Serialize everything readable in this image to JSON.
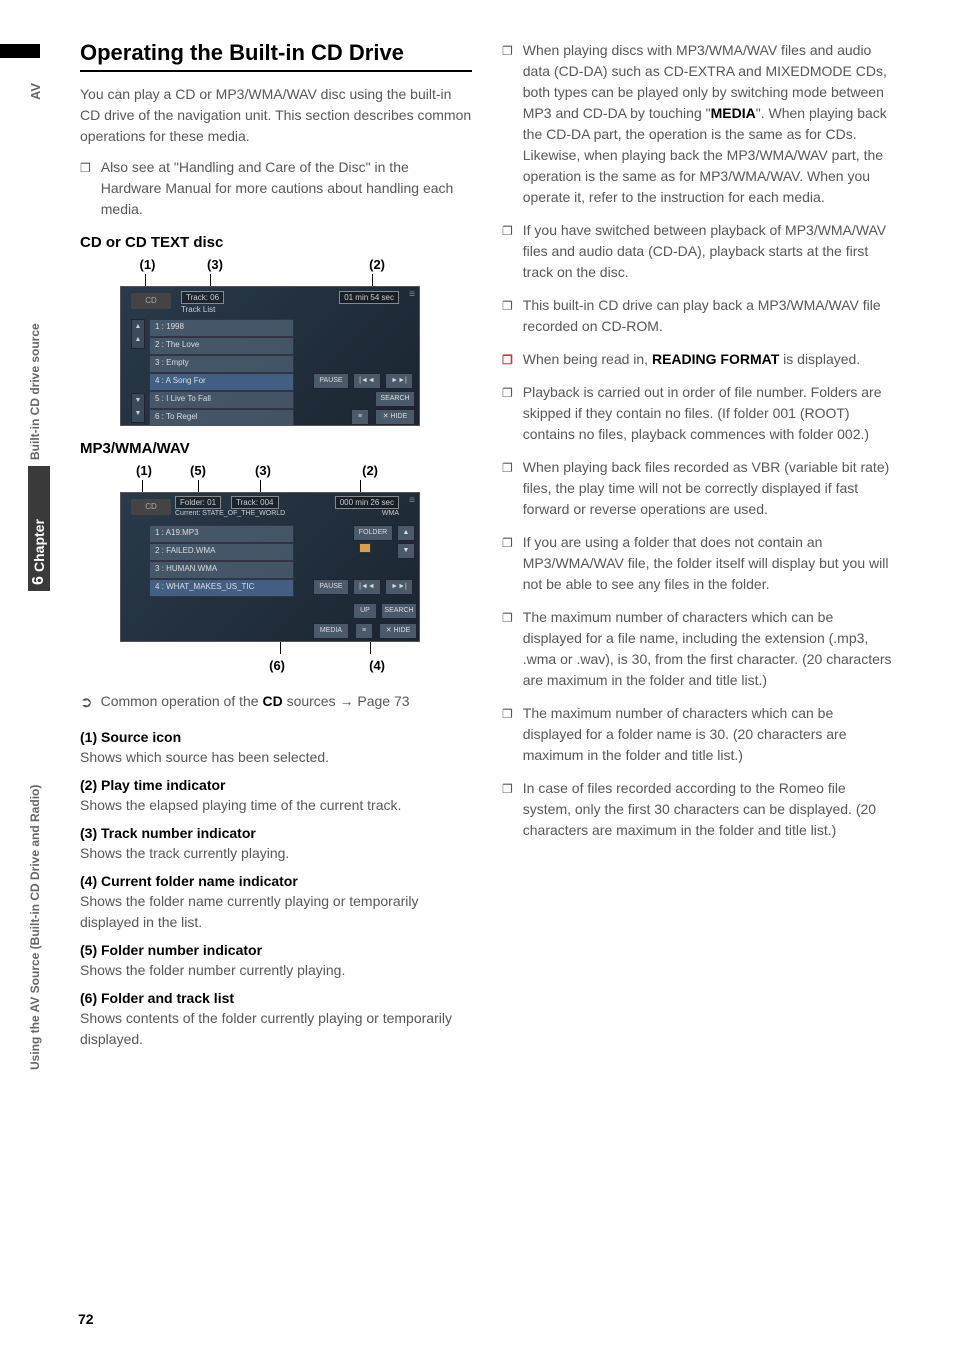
{
  "side": {
    "av": "AV",
    "built_in": "Built-in CD drive source",
    "chapter_label": "Chapter",
    "chapter_num": "6",
    "using": "Using the AV Source (Built-in CD Drive and Radio)"
  },
  "left": {
    "title": "Operating the Built-in CD Drive",
    "intro": "You can play a CD or MP3/WMA/WAV disc using the built-in CD drive of the navigation unit. This section describes common operations for these media.",
    "also_see": "Also see at \"Handling and Care of the Disc\" in the Hardware Manual for more cautions about handling each media.",
    "heading1": "CD or CD TEXT disc",
    "fig1": {
      "labels": {
        "l1": "(1)",
        "l3": "(3)",
        "l2": "(2)"
      },
      "cd": "CD",
      "track": "Track: 06",
      "tracklist": "Track List",
      "time": "01 min  54 sec",
      "rows": [
        "1 : 1998",
        "2 : The Love",
        "3 : Empty",
        "4 : A Song For",
        "5 : I Live To Fall",
        "6 : To Regel"
      ],
      "btns": {
        "pause": "PAUSE",
        "prev": "|◄◄",
        "next": "►►|",
        "search": "SEARCH",
        "hide": "✕ HIDE",
        "list": "≡"
      }
    },
    "heading2": "MP3/WMA/WAV",
    "fig2": {
      "labels": {
        "l1": "(1)",
        "l5": "(5)",
        "l3": "(3)",
        "l2": "(2)",
        "l6": "(6)",
        "l4": "(4)"
      },
      "cd": "CD",
      "folder": "Folder: 01",
      "track": "Track: 004",
      "current": "Current: STATE_OF_THE_WORLD",
      "time": "000 min  26 sec",
      "wma": "WMA",
      "rows": [
        "1 : A19.MP3",
        "2 : FAILED.WMA",
        "3 : HUMAN.WMA",
        "4 : WHAT_MAKES_US_TIC"
      ],
      "btns": {
        "pause": "PAUSE",
        "prev": "|◄◄",
        "next": "►►|",
        "up": "UP",
        "search": "SEARCH",
        "media": "MEDIA",
        "hide": "✕ HIDE",
        "list": "≡",
        "folder_btn": "FOLDER",
        "fup": "▲",
        "fdown": "▼"
      }
    },
    "common_op_intro": "Common operation of the ",
    "common_op_cd": "CD",
    "common_op_sources": " sources ",
    "common_op_page": "Page 73",
    "descs": [
      {
        "title": "(1) Source icon",
        "text": "Shows which source has been selected."
      },
      {
        "title": "(2) Play time indicator",
        "text": "Shows the elapsed playing time of the current track."
      },
      {
        "title": "(3) Track number indicator",
        "text": "Shows the track currently playing."
      },
      {
        "title": "(4) Current folder name indicator",
        "text": "Shows the folder name currently playing or temporarily displayed in the list."
      },
      {
        "title": "(5) Folder number indicator",
        "text": "Shows the folder number currently playing."
      },
      {
        "title": "(6) Folder and track list",
        "text": "Shows contents of the folder currently playing or temporarily displayed."
      }
    ]
  },
  "right": {
    "items": [
      {
        "parts": [
          {
            "t": "When playing discs with MP3/WMA/WAV files and audio data (CD-DA) such as CD-EXTRA and MIXEDMODE CDs, both types can be played only by switching mode between MP3 and CD-DA by touching \""
          },
          {
            "t": "MEDIA",
            "bold": true
          },
          {
            "t": "\". When playing back the CD-DA part, the operation is the same as for CDs."
          },
          {
            "br": true
          },
          {
            "t": "Likewise, when playing back the MP3/WMA/WAV part, the operation is the same as for MP3/WMA/WAV. When you operate it, refer to the instruction for each media."
          }
        ]
      },
      {
        "parts": [
          {
            "t": "If you have switched between playback of MP3/WMA/WAV files and audio data (CD-DA), playback starts at the first track on the disc."
          }
        ]
      },
      {
        "parts": [
          {
            "t": "This built-in CD drive can play back a MP3/WMA/WAV file recorded on CD-ROM."
          }
        ]
      },
      {
        "red": true,
        "parts": [
          {
            "t": "When being read in, "
          },
          {
            "t": "READING FORMAT",
            "bold": true
          },
          {
            "t": " is displayed."
          }
        ]
      },
      {
        "parts": [
          {
            "t": "Playback is carried out in order of file number. Folders are skipped if they contain no files. (If folder 001 (ROOT) contains no files, playback commences with folder 002.)"
          }
        ]
      },
      {
        "parts": [
          {
            "t": "When playing back files recorded as VBR (variable bit rate) files, the play time will not be correctly displayed if fast forward or reverse operations are used."
          }
        ]
      },
      {
        "parts": [
          {
            "t": "If you are using a folder that does not contain an MP3/WMA/WAV file, the folder itself will display but you will not be able to see any files in the folder."
          }
        ]
      },
      {
        "parts": [
          {
            "t": "The maximum number of characters which can be displayed for a file name, including the extension (.mp3, .wma or .wav), is 30, from the first character. (20 characters are maximum in the folder and title list.)"
          }
        ]
      },
      {
        "parts": [
          {
            "t": "The maximum number of characters which can be displayed for a folder name is 30. (20 characters are maximum in the folder and title list.)"
          }
        ]
      },
      {
        "parts": [
          {
            "t": "In case of files recorded according to the Romeo file system, only the first 30 characters can be displayed. (20 characters are maximum in the folder and title list.)"
          }
        ]
      }
    ]
  },
  "page_num": "72"
}
